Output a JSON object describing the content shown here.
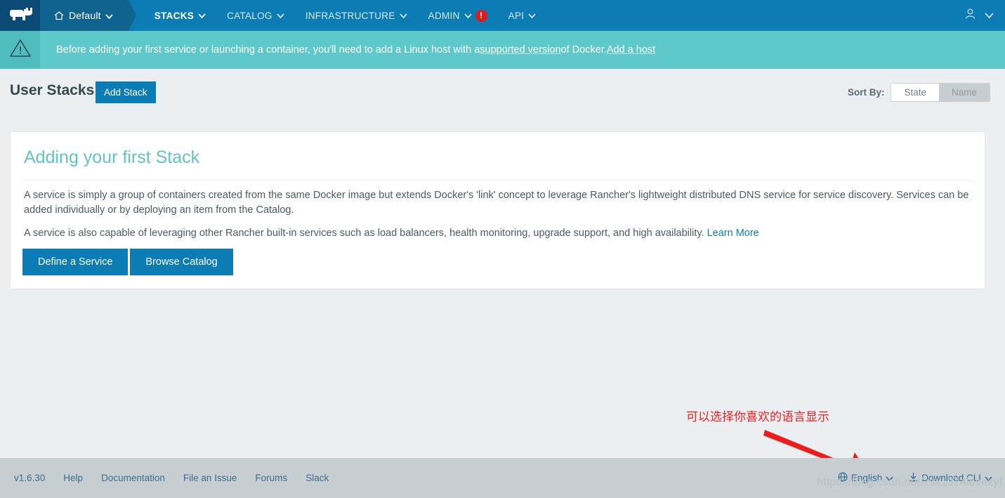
{
  "topnav": {
    "logo_icon": "rancher-cow-logo",
    "environment": {
      "icon": "home-icon",
      "label": "Default",
      "caret": "chevron-down-icon"
    },
    "items": [
      {
        "label": "STACKS",
        "active": true,
        "caret": "chevron-down-icon"
      },
      {
        "label": "CATALOG",
        "active": false,
        "caret": "chevron-down-icon"
      },
      {
        "label": "INFRASTRUCTURE",
        "active": false,
        "caret": "chevron-down-icon"
      },
      {
        "label": "ADMIN",
        "active": false,
        "caret": "chevron-down-icon",
        "badge": "!"
      },
      {
        "label": "API",
        "active": false,
        "caret": "chevron-down-icon"
      }
    ],
    "user": {
      "icon": "user-avatar-icon",
      "caret": "chevron-down-icon"
    },
    "accent": "#0c7cb4"
  },
  "banner": {
    "icon": "warning-triangle-icon",
    "text_before": "Before adding your first service or launching a container, you'll need to add a Linux host with a ",
    "link_supported": "supported version",
    "text_middle": " of Docker. ",
    "link_addhost": "Add a host",
    "background": "#5ec8ca"
  },
  "pagehead": {
    "title": "User Stacks",
    "add_stack_label": "Add Stack",
    "sort_by_label": "Sort By:",
    "sort_options": [
      {
        "label": "State",
        "selected": true
      },
      {
        "label": "Name",
        "selected": false
      }
    ]
  },
  "card": {
    "title": "Adding your first Stack",
    "paragraph1": "A service is simply a group of containers created from the same Docker image but extends Docker's 'link' concept to leverage Rancher's lightweight distributed DNS service for service discovery. Services can be added individually or by deploying an item from the Catalog.",
    "paragraph2": "A service is also capable of leveraging other Rancher built-in services such as load balancers, health monitoring, upgrade support, and high availability. ",
    "learn_more": "Learn More",
    "buttons": [
      {
        "label": "Define a Service"
      },
      {
        "label": "Browse Catalog"
      }
    ],
    "title_color": "#63c2c6"
  },
  "annotation": {
    "text": "可以选择你喜欢的语言显示",
    "color": "#ee2222",
    "arrow": "red-arrow-pointing-to-language-selector"
  },
  "footer": {
    "left_items": [
      {
        "label": "v1.6.30"
      },
      {
        "label": "Help"
      },
      {
        "label": "Documentation"
      },
      {
        "label": "File an Issue"
      },
      {
        "label": "Forums"
      },
      {
        "label": "Slack"
      }
    ],
    "language": {
      "icon": "globe-icon",
      "label": "English",
      "caret": "chevron-down-icon"
    },
    "download_cli": {
      "icon": "download-icon",
      "label": "Download CLI",
      "caret": "chevron-down-icon"
    },
    "background": "#c7ced2"
  },
  "watermark": {
    "text": "https://blog.csdn.net/zsx1314lovezyf"
  }
}
